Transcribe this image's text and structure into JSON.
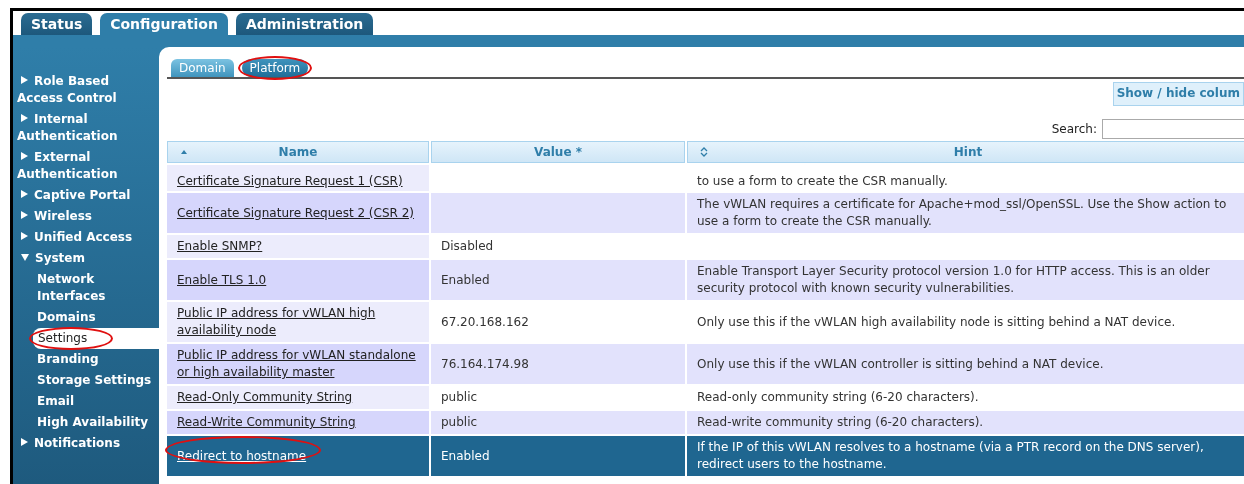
{
  "top_tabs": [
    {
      "label": "Status",
      "selected": false
    },
    {
      "label": "Configuration",
      "selected": true
    },
    {
      "label": "Administration",
      "selected": false
    }
  ],
  "sidebar": {
    "items": [
      {
        "label": "Role Based Access Control",
        "expanded": false
      },
      {
        "label": "Internal Authentication",
        "expanded": false
      },
      {
        "label": "External Authentication",
        "expanded": false
      },
      {
        "label": "Captive Portal",
        "expanded": false
      },
      {
        "label": "Wireless",
        "expanded": false
      },
      {
        "label": "Unified Access",
        "expanded": false
      },
      {
        "label": "System",
        "expanded": true,
        "children": [
          {
            "label": "Network Interfaces",
            "selected": false,
            "circled": false
          },
          {
            "label": "Domains",
            "selected": false,
            "circled": false
          },
          {
            "label": "Settings",
            "selected": true,
            "circled": true
          },
          {
            "label": "Branding",
            "selected": false,
            "circled": false
          },
          {
            "label": "Storage Settings",
            "selected": false,
            "circled": false
          },
          {
            "label": "Email",
            "selected": false,
            "circled": false
          },
          {
            "label": "High Availability",
            "selected": false,
            "circled": false
          }
        ]
      },
      {
        "label": "Notifications",
        "expanded": false
      }
    ]
  },
  "sub_tabs": [
    {
      "label": "Domain",
      "selected": false,
      "circled": false
    },
    {
      "label": "Platform",
      "selected": true,
      "circled": true
    }
  ],
  "show_hide_button": "Show / hide colum",
  "search": {
    "label": "Search:"
  },
  "table": {
    "columns": [
      {
        "label": "Name",
        "sortable": true,
        "sorted": true
      },
      {
        "label": "Value *",
        "sortable": false,
        "sorted": false
      },
      {
        "label": "Hint",
        "sortable": true,
        "sorted": false
      }
    ],
    "rows": [
      {
        "name": "Certificate Signature Request 1 (CSR)",
        "value": "",
        "hint": "to use a form to create the CSR manually.",
        "selected": false,
        "circled": false
      },
      {
        "name": "Certificate Signature Request 2 (CSR 2)",
        "value": "",
        "hint": "The vWLAN requires a certificate for Apache+mod_ssl/OpenSSL. Use the Show action to use a form to create the CSR manually.",
        "selected": false,
        "circled": false
      },
      {
        "name": "Enable SNMP?",
        "value": "Disabled",
        "hint": "",
        "selected": false,
        "circled": false
      },
      {
        "name": "Enable TLS 1.0",
        "value": "Enabled",
        "hint": "Enable Transport Layer Security protocol version 1.0 for HTTP access. This is an older security protocol with known security vulnerabilities.",
        "selected": false,
        "circled": false
      },
      {
        "name": "Public IP address for vWLAN high availability node",
        "value": "67.20.168.162",
        "hint": "Only use this if the vWLAN high availability node is sitting behind a NAT device.",
        "selected": false,
        "circled": false
      },
      {
        "name": "Public IP address for vWLAN standalone or high availability master",
        "value": "76.164.174.98",
        "hint": "Only use this if the vWLAN controller is sitting behind a NAT device.",
        "selected": false,
        "circled": false
      },
      {
        "name": "Read-Only Community String",
        "value": "public",
        "hint": "Read-only community string (6-20 characters).",
        "selected": false,
        "circled": false
      },
      {
        "name": "Read-Write Community String",
        "value": "public",
        "hint": "Read-write community string (6-20 characters).",
        "selected": false,
        "circled": false
      },
      {
        "name": "Redirect to hostname",
        "value": "Enabled",
        "hint": "If the IP of this vWLAN resolves to a hostname (via a PTR record on the DNS server), redirect users to the hostname.",
        "selected": true,
        "circled": true
      }
    ]
  }
}
